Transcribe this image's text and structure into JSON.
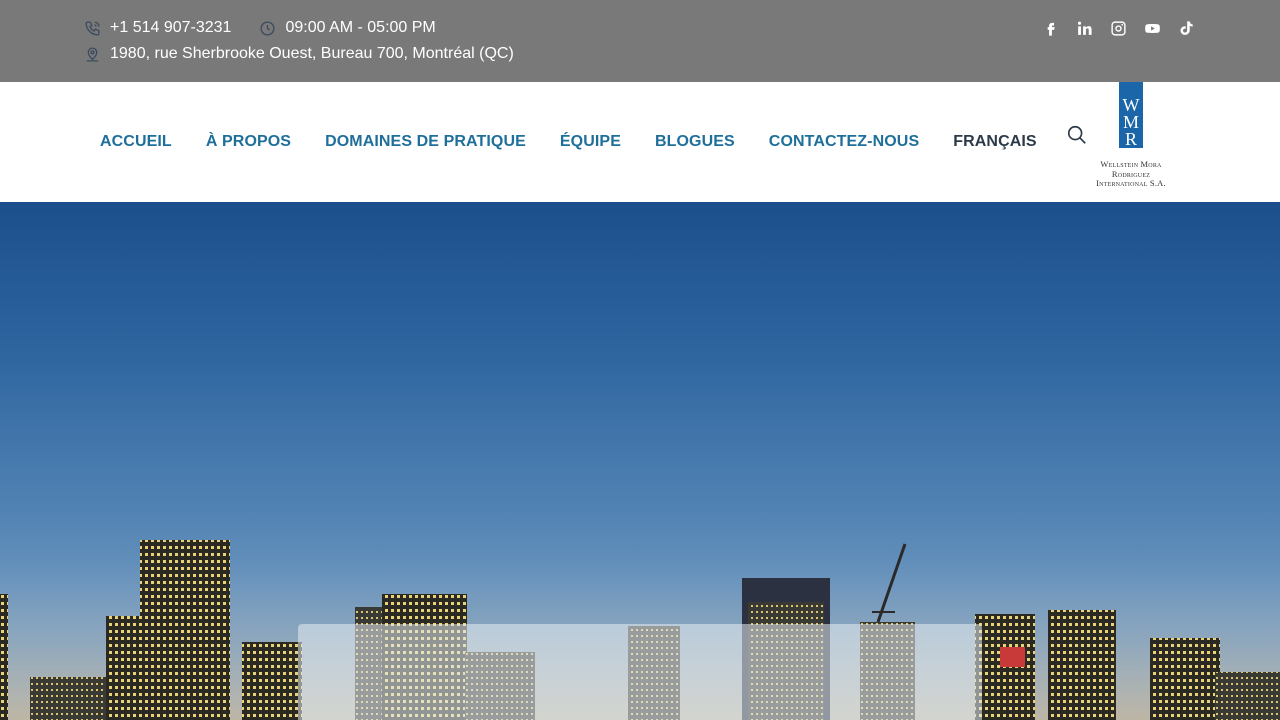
{
  "topbar": {
    "phone": "+1 514 907-3231",
    "hours": "09:00 AM - 05:00 PM",
    "address": "1980, rue Sherbrooke Ouest, Bureau 700, Montréal (QC)",
    "icons": {
      "phone": "phone-icon",
      "clock": "clock-icon",
      "location": "location-pin-icon"
    },
    "social": [
      "facebook-icon",
      "linkedin-icon",
      "instagram-icon",
      "youtube-icon",
      "tiktok-icon"
    ]
  },
  "nav": {
    "items": [
      "ACCUEIL",
      "À PROPOS",
      "DOMAINES DE PRATIQUE",
      "ÉQUIPE",
      "BLOGUES",
      "CONTACTEZ-NOUS"
    ],
    "language": "FRANÇAIS",
    "search_icon": "search-icon"
  },
  "logo": {
    "letters": [
      "W",
      "M",
      "R"
    ],
    "line1": "Wellstein Mora",
    "line2": "Rodriguez",
    "line3": "International S.A."
  },
  "colors": {
    "topbar_bg": "#797979",
    "nav_link": "#1f6f9b",
    "nav_lang": "#2c3a47",
    "logo_blue": "#1a66a8"
  }
}
